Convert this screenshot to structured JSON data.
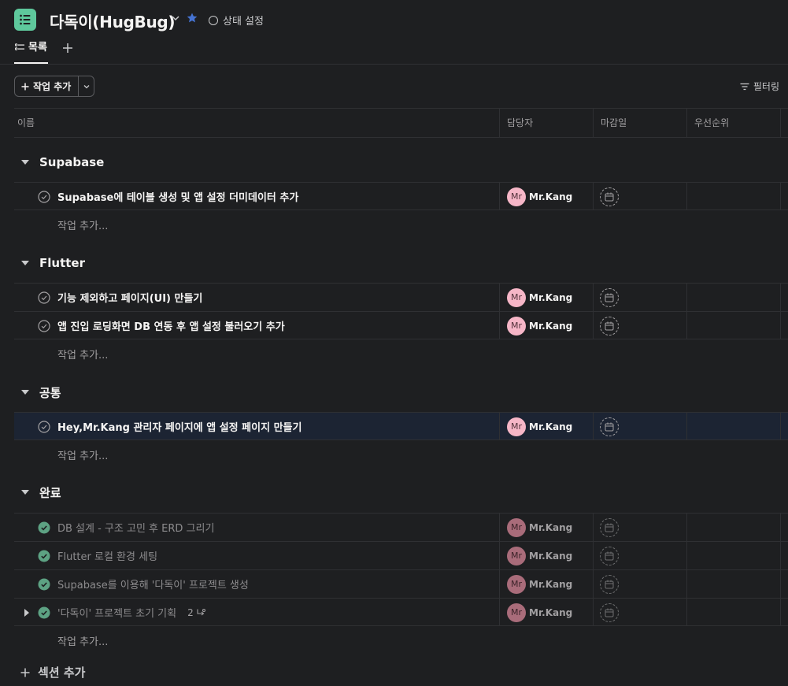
{
  "header": {
    "title": "다독이(HugBug)",
    "status_label": "상태 설정",
    "tab_list_label": "목록",
    "accent": "#5ec89c",
    "star_color": "#4573d2"
  },
  "toolbar": {
    "add_task_label": "작업 추가",
    "filter_label": "필터링"
  },
  "columns": {
    "name": "이름",
    "assignee": "담당자",
    "due": "마감일",
    "priority": "우선순위"
  },
  "add_task_row": "작업 추가...",
  "add_section_label": "섹션 추가",
  "sections": [
    {
      "name": "Supabase",
      "tasks": [
        {
          "name": "Supabase에 테이블 생성 및 앱 설정 더미데이터 추가",
          "avatar": "Mr",
          "assignee": "Mr.Kang",
          "done": false
        }
      ]
    },
    {
      "name": "Flutter",
      "tasks": [
        {
          "name": "기능 제외하고 페이지(UI) 만들기",
          "avatar": "Mr",
          "assignee": "Mr.Kang",
          "done": false
        },
        {
          "name": "앱 진입 로딩화면 DB 연동 후 앱 설정 불러오기 추가",
          "avatar": "Mr",
          "assignee": "Mr.Kang",
          "done": false
        }
      ]
    },
    {
      "name": "공통",
      "tasks": [
        {
          "name": "Hey,Mr.Kang 관리자 페이지에 앱 설정 페이지 만들기",
          "avatar": "Mr",
          "assignee": "Mr.Kang",
          "done": false
        }
      ]
    },
    {
      "name": "완료",
      "tasks": [
        {
          "name": "DB 설계 - 구조 고민 후 ERD 그리기",
          "avatar": "Mr",
          "assignee": "Mr.Kang",
          "done": true
        },
        {
          "name": "Flutter 로컬 환경 세팅",
          "avatar": "Mr",
          "assignee": "Mr.Kang",
          "done": true
        },
        {
          "name": "Supabase를 이용해 '다독이' 프로젝트 생성",
          "avatar": "Mr",
          "assignee": "Mr.Kang",
          "done": true
        },
        {
          "name": "'다독이' 프로젝트 초기 기획",
          "avatar": "Mr",
          "assignee": "Mr.Kang",
          "done": true,
          "subtask_count": "2"
        }
      ]
    }
  ]
}
